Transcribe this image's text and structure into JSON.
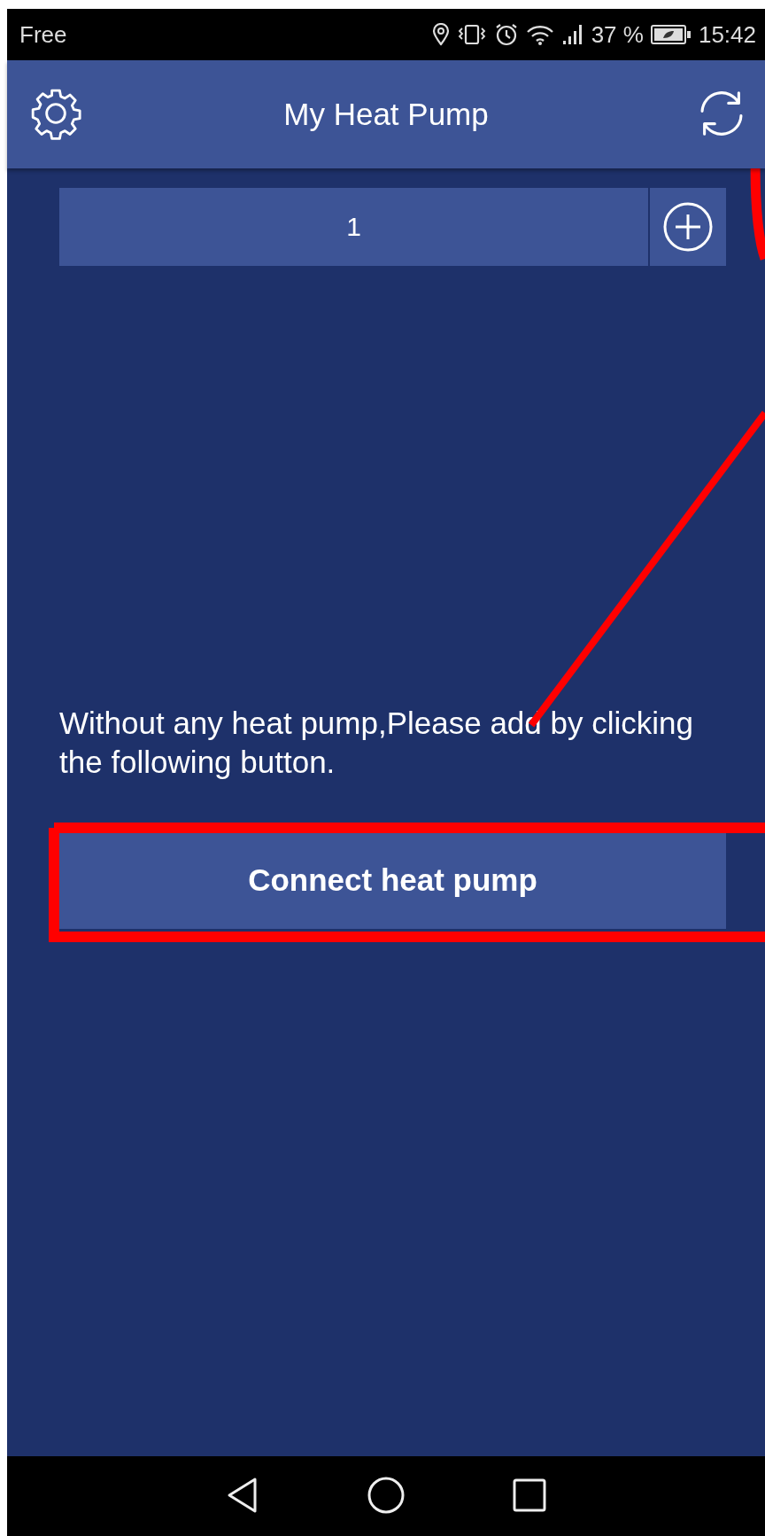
{
  "status_bar": {
    "carrier": "Free",
    "battery_percent": "37 %",
    "time": "15:42"
  },
  "header": {
    "title": "My Heat Pump"
  },
  "pump_tabs": [
    {
      "label": "1"
    }
  ],
  "message": "Without any heat pump,Please add by clicking the following button.",
  "connect_button": {
    "label": "Connect heat pump"
  },
  "annotations": [
    {
      "kind": "ellipse"
    },
    {
      "kind": "line"
    },
    {
      "kind": "rect"
    }
  ]
}
